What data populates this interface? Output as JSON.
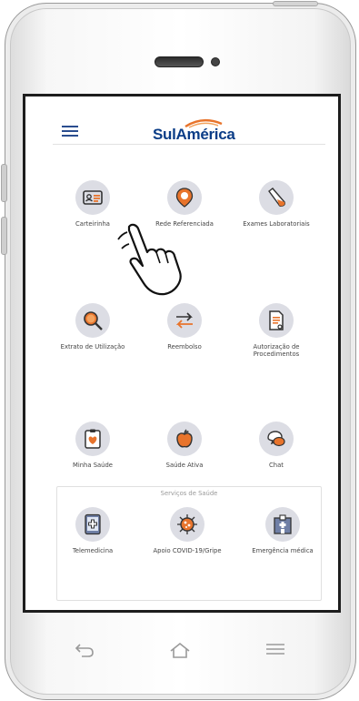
{
  "brand": {
    "name": "SulAmérica",
    "accent": "#0b3d87",
    "swoosh": "#e8742c",
    "icon_bg": "#dcdde4",
    "icon_accent": "#e8742c"
  },
  "header": {
    "menu_icon": "hamburger-icon"
  },
  "menu_rows": [
    [
      {
        "label": "Carteirinha",
        "icon": "id-card-icon"
      },
      {
        "label": "Rede Referenciada",
        "icon": "map-pin-icon"
      },
      {
        "label": "Exames Laboratoriais",
        "icon": "test-tube-icon"
      }
    ],
    [
      {
        "label": "Extrato de Utilização",
        "icon": "magnifier-icon"
      },
      {
        "label": "Reembolso",
        "icon": "swap-arrows-icon"
      },
      {
        "label": "Autorização de Procedimentos",
        "icon": "document-icon"
      }
    ],
    [
      {
        "label": "Minha Saúde",
        "icon": "clipboard-heart-icon"
      },
      {
        "label": "Saúde Ativa",
        "icon": "apple-icon"
      },
      {
        "label": "Chat",
        "icon": "chat-bubbles-icon"
      }
    ]
  ],
  "services": {
    "title": "Serviços de Saúde",
    "items": [
      {
        "label": "Telemedicina",
        "icon": "tablet-medical-icon"
      },
      {
        "label": "Apoio COVID-19/Gripe",
        "icon": "virus-icon"
      },
      {
        "label": "Emergência médica",
        "icon": "hospital-icon"
      }
    ]
  },
  "device_nav": {
    "back": "back-arrow-icon",
    "home": "home-icon",
    "menu": "menu-lines-icon"
  }
}
